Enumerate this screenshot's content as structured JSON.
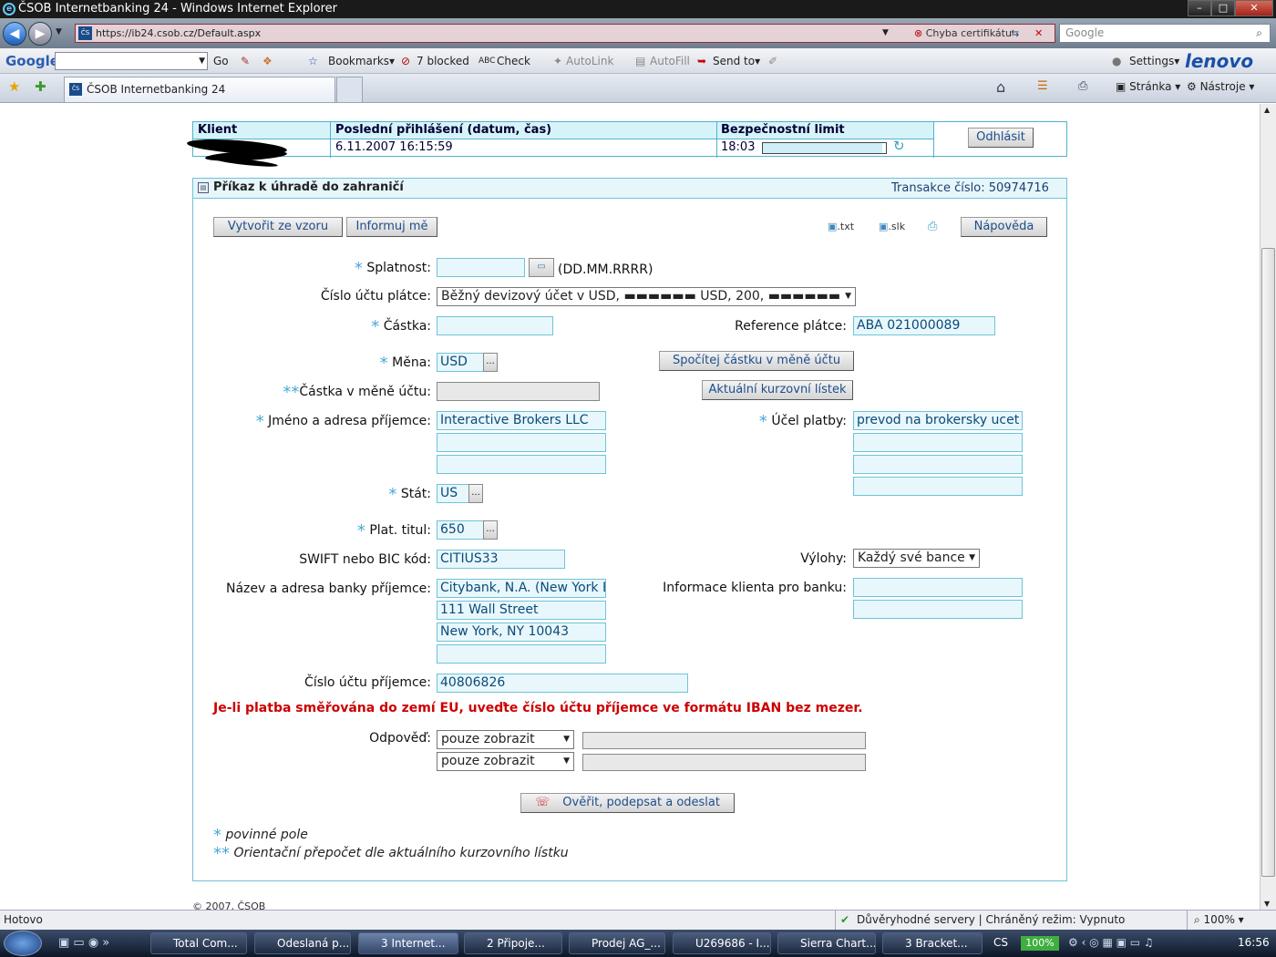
{
  "window": {
    "title": "ČSOB Internetbanking 24 - Windows Internet Explorer",
    "minimize": "–",
    "maximize": "□",
    "close": "✕"
  },
  "address": {
    "url": "https://ib24.csob.cz/Default.aspx",
    "cert_error": "Chyba certifikátu",
    "search_placeholder": "Google"
  },
  "toolbar": {
    "google": "Google",
    "go": "Go",
    "bookmarks": "Bookmarks▾",
    "blocked": "7 blocked",
    "check": "Check",
    "autolink": "AutoLink",
    "autofill": "AutoFill",
    "sendto": "Send to▾",
    "settings": "Settings▾",
    "brand": "lenovo"
  },
  "tabs": {
    "active": "ČSOB Internetbanking 24",
    "page_menu": "Stránka",
    "tools_menu": "Nástroje"
  },
  "header": {
    "col_client": "Klient",
    "col_last_login": "Poslední přihlášení (datum, čas)",
    "col_security": "Bezpečnostní limit",
    "last_login_value": "6.11.2007 16:15:59",
    "timer": "18:03",
    "logout": "Odhlásit"
  },
  "form": {
    "title": "Příkaz k úhradě do zahraničí",
    "transaction": "Transakce číslo: 50974716",
    "btn_template": "Vytvořit ze vzoru",
    "btn_inform": "Informuj mě",
    "export_txt": ".txt",
    "export_slk": ".slk",
    "btn_help": "Nápověda",
    "lbl_due": "Splatnost:",
    "due_format": "(DD.MM.RRRR)",
    "lbl_payer_account": "Číslo účtu plátce:",
    "payer_account_value": "Běžný devizový účet v USD,  ▬▬▬▬▬▬ USD, 200,  ▬▬▬▬▬▬",
    "lbl_amount": "Částka:",
    "lbl_payer_ref": "Reference plátce:",
    "payer_ref_value": "ABA 021000089",
    "lbl_currency": "Měna:",
    "currency_value": "USD",
    "btn_calc": "Spočítej částku v měně účtu",
    "lbl_amount_account": "Částka v měně účtu:",
    "btn_rates": "Aktuální kurzovní lístek",
    "lbl_recipient": "Jméno a adresa příjemce:",
    "recipient_line1": "Interactive Brokers LLC",
    "lbl_purpose": "Účel platby:",
    "purpose_line1": "prevod na brokersky ucet",
    "lbl_country": "Stát:",
    "country_value": "US",
    "lbl_title": "Plat. titul:",
    "title_value": "650",
    "lbl_swift": "SWIFT nebo BIC kód:",
    "swift_value": "CITIUS33",
    "lbl_fees": "Výlohy:",
    "fees_value": "Každý své bance",
    "lbl_bank": "Název a adresa banky příjemce:",
    "bank_line1": "Citybank, N.A. (New York Br",
    "bank_line2": "111 Wall Street",
    "bank_line3": "New York, NY 10043",
    "lbl_client_info": "Informace klienta pro banku:",
    "lbl_recipient_account": "Číslo účtu příjemce:",
    "recipient_account_value": "40806826",
    "eu_warning": "Je-li platba směřována do zemí EU, uveďte číslo účtu příjemce ve formátu IBAN bez mezer.",
    "lbl_response": "Odpověď:",
    "response1": "pouze zobrazit",
    "response2": "pouze zobrazit",
    "btn_submit": "Ověřit, podepsat a odeslat",
    "req_star": "*",
    "req_star2": "**",
    "note1": "povinné pole",
    "note2": "Orientační přepočet dle aktuálního kurzovního lístku",
    "footer": "© 2007, ČSOB"
  },
  "status": {
    "left": "Hotovo",
    "zone": "Důvěryhodné servery | Chráněný režim: Vypnuto",
    "zoom": "100%"
  },
  "taskbar": {
    "items": [
      "Total Com...",
      "Odeslaná p...",
      "3 Internet...",
      "2 Připoje...",
      "Prodej AG_...",
      "U269686 - I...",
      "Sierra Chart...",
      "3 Bracket..."
    ],
    "lang": "CS",
    "battery": "100%",
    "clock": "16:56"
  },
  "colors": {
    "accent": "#4fb3cc",
    "header_fill": "#d7f3fa",
    "input_fill": "#e8f7fb",
    "warning": "#cc0000"
  }
}
